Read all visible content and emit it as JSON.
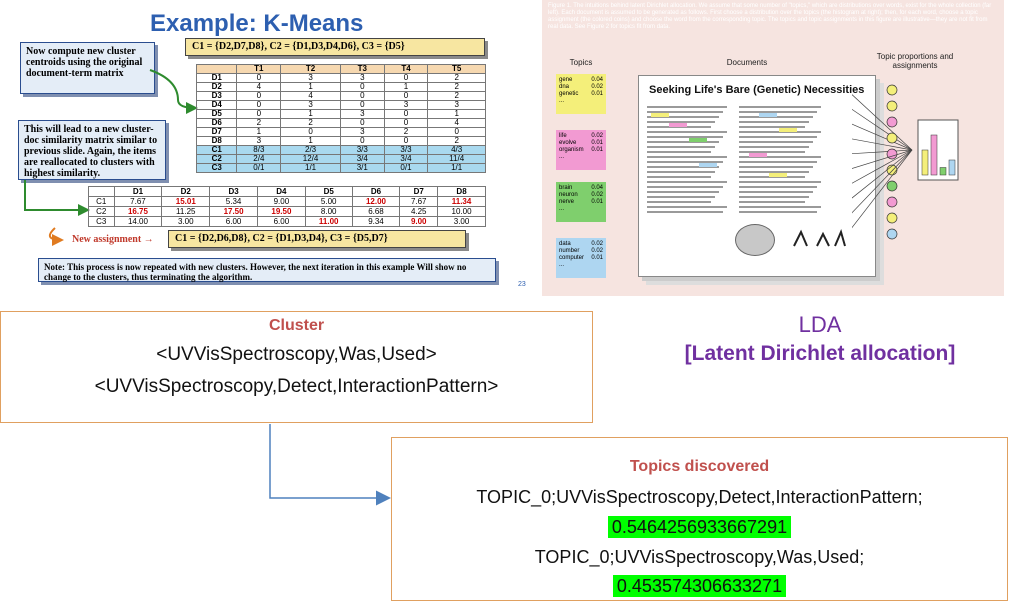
{
  "kmeans": {
    "title": "Example: K-Means",
    "note_centroids": "Now compute new cluster centroids using the original document-term matrix",
    "note_similarity": "This will lead to a new cluster-doc similarity matrix similar to previous slide. Again, the items are reallocated to clusters with highest similarity.",
    "clusters_old": "C1 = {D2,D7,D8},     C2 = {D1,D3,D4,D6},     C3 = {D5}",
    "new_assignment_label": "New assignment →",
    "clusters_new": "C1 = {D2,D6,D8},    C2 = {D1,D3,D4},    C3 = {D5,D7}",
    "note_bottom": "Note: This process is now repeated with new clusters. However, the next iteration in this example Will show no change to the clusters, thus terminating the algorithm.",
    "page_num": "23",
    "term_headers": [
      "",
      "T1",
      "T2",
      "T3",
      "T4",
      "T5"
    ],
    "term_rows": [
      [
        "D1",
        "0",
        "3",
        "3",
        "0",
        "2"
      ],
      [
        "D2",
        "4",
        "1",
        "0",
        "1",
        "2"
      ],
      [
        "D3",
        "0",
        "4",
        "0",
        "0",
        "2"
      ],
      [
        "D4",
        "0",
        "3",
        "0",
        "3",
        "3"
      ],
      [
        "D5",
        "0",
        "1",
        "3",
        "0",
        "1"
      ],
      [
        "D6",
        "2",
        "2",
        "0",
        "0",
        "4"
      ],
      [
        "D7",
        "1",
        "0",
        "3",
        "2",
        "0"
      ],
      [
        "D8",
        "3",
        "1",
        "0",
        "0",
        "2"
      ]
    ],
    "centroid_rows": [
      [
        "C1",
        "8/3",
        "2/3",
        "3/3",
        "3/3",
        "4/3"
      ],
      [
        "C2",
        "2/4",
        "12/4",
        "3/4",
        "3/4",
        "11/4"
      ],
      [
        "C3",
        "0/1",
        "1/1",
        "3/1",
        "0/1",
        "1/1"
      ]
    ],
    "sim_headers": [
      "",
      "D1",
      "D2",
      "D3",
      "D4",
      "D5",
      "D6",
      "D7",
      "D8"
    ],
    "sim_rows": [
      [
        "C1",
        "7.67",
        "15.01",
        "5.34",
        "9.00",
        "5.00",
        "12.00",
        "7.67",
        "11.34"
      ],
      [
        "C2",
        "16.75",
        "11.25",
        "17.50",
        "19.50",
        "8.00",
        "6.68",
        "4.25",
        "10.00"
      ],
      [
        "C3",
        "14.00",
        "3.00",
        "6.00",
        "6.00",
        "11.00",
        "9.34",
        "9.00",
        "3.00"
      ]
    ],
    "sim_highlight": [
      [
        2,
        6,
        8
      ],
      [
        1,
        3,
        4
      ],
      [
        5,
        7
      ]
    ]
  },
  "lda_figure": {
    "caption": "Figure 1. The intuitions behind latent Dirichlet allocation. We assume that some number of \"topics,\" which are distributions over words, exist for the whole collection (far left). Each document is assumed to be generated as follows. First choose a distribution over the topics (the histogram at right); then, for each word, choose a topic assignment (the colored coins) and choose the word from the corresponding topic. The topics and topic assignments in this figure are illustrative—they are not fit from real data. See Figure 2 for topics fit from data.",
    "col_topics": "Topics",
    "col_documents": "Documents",
    "col_proportions": "Topic proportions and assignments",
    "doc_title": "Seeking Life's Bare (Genetic) Necessities",
    "topic_cards": [
      {
        "color": "#f4ef7a",
        "words": [
          [
            "gene",
            "0.04"
          ],
          [
            "dna",
            "0.02"
          ],
          [
            "genetic",
            "0.01"
          ],
          [
            "...",
            ""
          ]
        ]
      },
      {
        "color": "#f29ad2",
        "words": [
          [
            "life",
            "0.02"
          ],
          [
            "evolve",
            "0.01"
          ],
          [
            "organism",
            "0.01"
          ],
          [
            "...",
            ""
          ]
        ]
      },
      {
        "color": "#7fcf6d",
        "words": [
          [
            "brain",
            "0.04"
          ],
          [
            "neuron",
            "0.02"
          ],
          [
            "nerve",
            "0.01"
          ],
          [
            "...",
            ""
          ]
        ]
      },
      {
        "color": "#aed6f1",
        "words": [
          [
            "data",
            "0.02"
          ],
          [
            "number",
            "0.02"
          ],
          [
            "computer",
            "0.01"
          ],
          [
            "...",
            ""
          ]
        ]
      }
    ],
    "coin_colors": [
      "#f4ef7a",
      "#f29ad2",
      "#7fcf6d",
      "#aed6f1"
    ]
  },
  "cluster_box": {
    "title": "Cluster",
    "line1": "<UVVisSpectroscopy,Was,Used>",
    "line2": "<UVVisSpectroscopy,Detect,InteractionPattern>"
  },
  "lda_label": "LDA",
  "lda_fullname": "[Latent Dirichlet allocation]",
  "topics_box": {
    "title": "Topics discovered",
    "topic1": "TOPIC_0;UVVisSpectroscopy,Detect,InteractionPattern;",
    "score1": "0.5464256933667291",
    "topic2": "TOPIC_0;UVVisSpectroscopy,Was,Used;",
    "score2": "0.453574306633271"
  },
  "colors": {
    "cluster_title": "#c0504d",
    "lda_purple": "#7030a0",
    "score_highlight": "#00ff00",
    "box_border": "#e0a060",
    "arrow": "#4f81bd"
  }
}
